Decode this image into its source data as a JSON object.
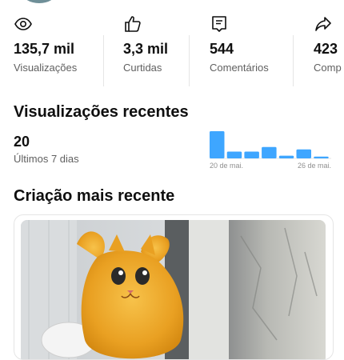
{
  "stats": [
    {
      "icon": "eye-icon",
      "value": "135,7 mil",
      "label": "Visualizações"
    },
    {
      "icon": "thumbs-up-icon",
      "value": "3,3 mil",
      "label": "Curtidas"
    },
    {
      "icon": "comment-icon",
      "value": "544",
      "label": "Comentários"
    },
    {
      "icon": "share-icon",
      "value": "423",
      "label": "Comp"
    }
  ],
  "recent_views": {
    "title": "Visualizações recentes",
    "count": "20",
    "period": "Últimos 7 dias",
    "chart_data": {
      "type": "bar",
      "x_start_label": "20 de mai.",
      "x_end_label": "26 de mai.",
      "values": [
        6,
        1.5,
        1.5,
        2.5,
        0.6,
        2,
        0.4
      ],
      "color": "#3ea6ff"
    }
  },
  "latest_creation": {
    "title": "Criação mais recente"
  }
}
